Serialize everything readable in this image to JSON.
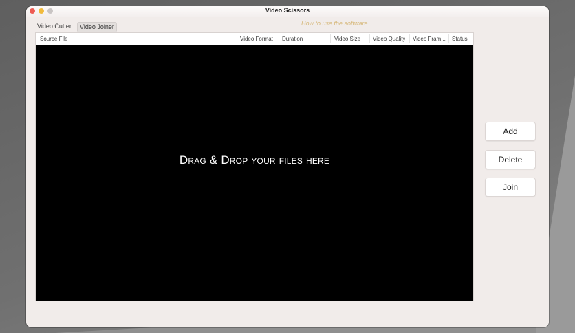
{
  "window": {
    "title": "Video Scissors"
  },
  "tabs": [
    {
      "label": "Video Cutter",
      "selected": false
    },
    {
      "label": "Video Joiner",
      "selected": true
    }
  ],
  "help_link": "How to use the software",
  "table": {
    "columns": [
      "Source File",
      "Video Format",
      "Duration",
      "Video Size",
      "Video Quality",
      "Video Fram...",
      "Status"
    ],
    "rows": [],
    "drop_hint": "Drag & Drop your files here"
  },
  "actions": {
    "add_label": "Add",
    "delete_label": "Delete",
    "join_label": "Join"
  },
  "colors": {
    "window_bg": "#f1ecea",
    "table_bg": "#000000",
    "help_link": "#d7b97c",
    "close": "#ee5b53",
    "minimize": "#f1bb3c"
  }
}
